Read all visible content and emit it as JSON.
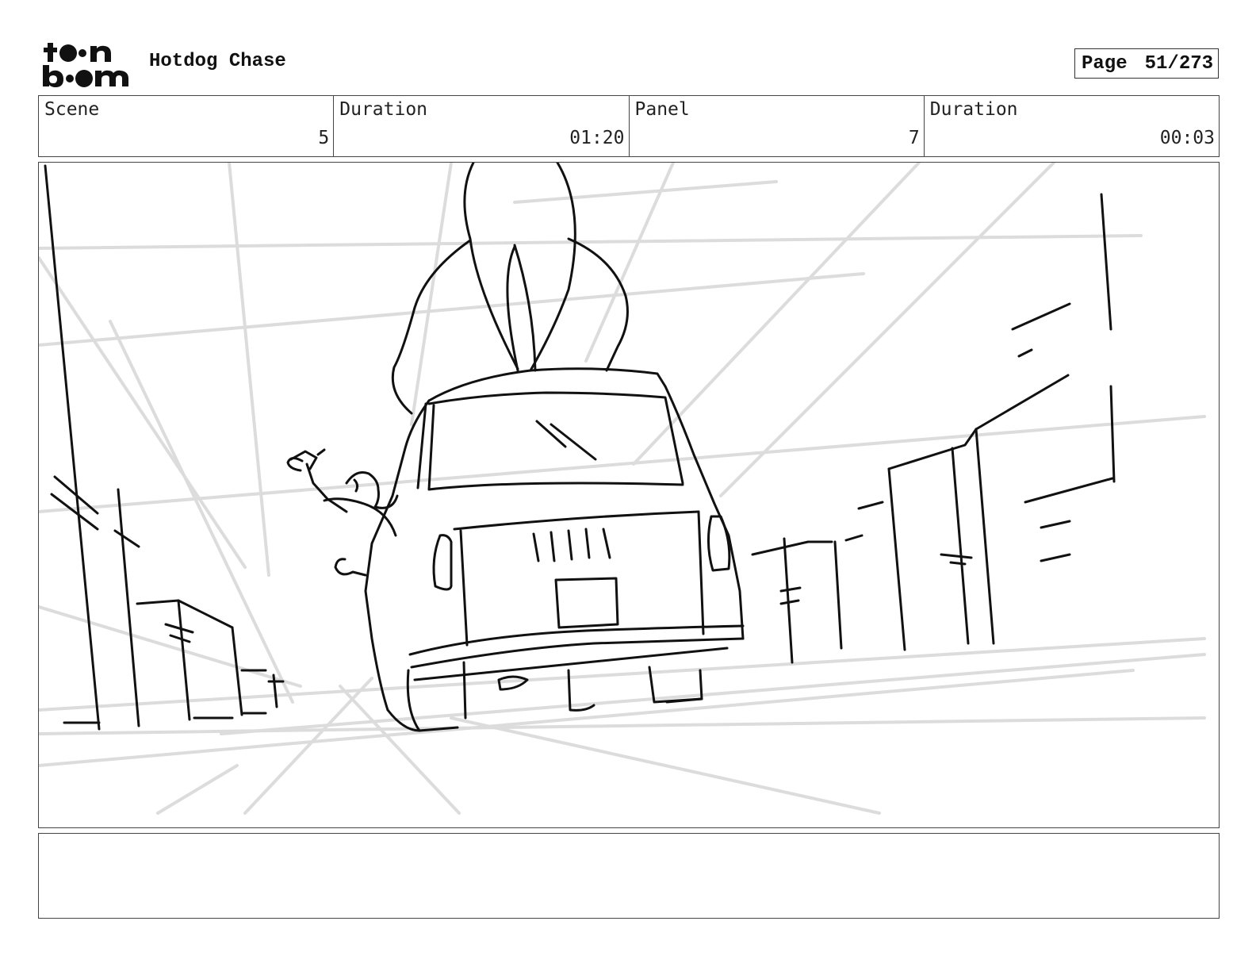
{
  "header": {
    "logo_text": "toon boom",
    "title": "Hotdog Chase",
    "page_label": "Page",
    "page_number": "51/273"
  },
  "info": {
    "scene_label": "Scene",
    "scene_value": "5",
    "scene_duration_label": "Duration",
    "scene_duration_value": "01:20",
    "panel_label": "Panel",
    "panel_value": "7",
    "panel_duration_label": "Duration",
    "panel_duration_value": "00:03"
  },
  "notes": {
    "text": ""
  }
}
